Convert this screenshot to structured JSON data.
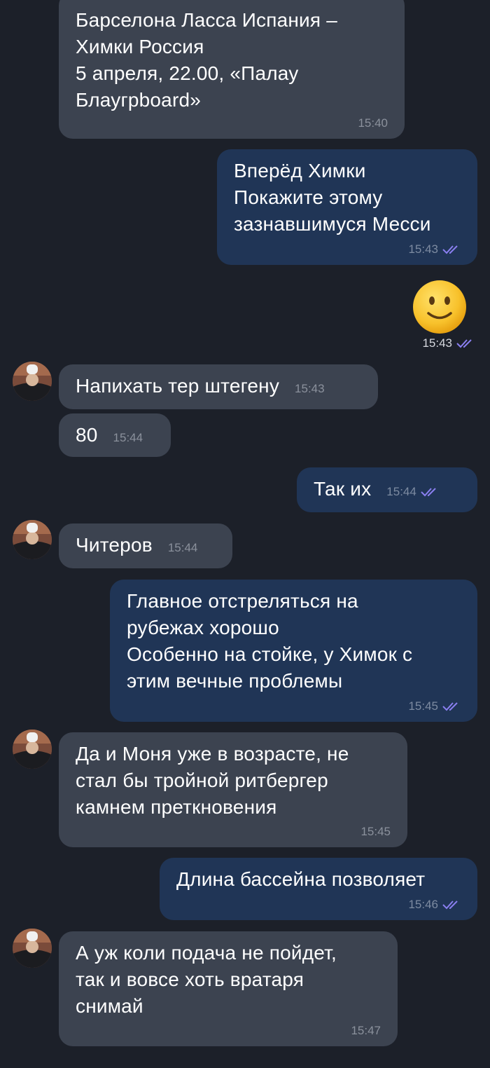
{
  "messages": [
    {
      "text": "Барселона Ласса Испания  –\nХимки Россия\n5 апреля, 22.00, «Палау\nБлаугрboard»",
      "time": "15:40"
    },
    {
      "text": "Вперёд Химки\nПокажите этому\nзазнавшимуся Месси",
      "time": "15:43"
    },
    {
      "emoji": "🙂",
      "time": "15:43"
    },
    {
      "text": "Напихать тер штегену",
      "time": "15:43"
    },
    {
      "text": "80",
      "time": "15:44"
    },
    {
      "text": "Так их",
      "time": "15:44"
    },
    {
      "text": "Читеров",
      "time": "15:44"
    },
    {
      "text": "Главное отстреляться на\nрубежах хорошо\nОсобенно на стойке, у Химок с\nэтим вечные проблемы",
      "time": "15:45"
    },
    {
      "text": "Да и Моня уже в возрасте, не\nстал бы тройной ритбергер\nкамнем преткновения",
      "time": "15:45"
    },
    {
      "text": "Длина бассейна позволяет",
      "time": "15:46"
    },
    {
      "text": "А уж коли подача не пойдет,\nтак и вовсе хоть вратаря\nснимай",
      "time": "15:47"
    }
  ],
  "colors": {
    "background": "#1c2029",
    "incoming_bubble": "#3c4350",
    "outgoing_bubble": "#203556",
    "read_check": "#8a7ff0"
  },
  "icons": {
    "read_receipt": "double-check-icon",
    "avatar": "user-avatar-photo"
  }
}
